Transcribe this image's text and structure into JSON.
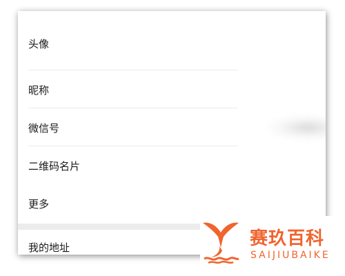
{
  "menu": {
    "items": [
      {
        "label": "头像"
      },
      {
        "label": "昵称"
      },
      {
        "label": "微信号"
      },
      {
        "label": "二维码名片"
      },
      {
        "label": "更多"
      },
      {
        "label": "我的地址"
      }
    ]
  },
  "watermark": {
    "brand": "赛玖百科",
    "subtitle": "SAIJIUBAIKE",
    "color": "#f0642e",
    "icon": "whale-tail-logo-icon"
  }
}
